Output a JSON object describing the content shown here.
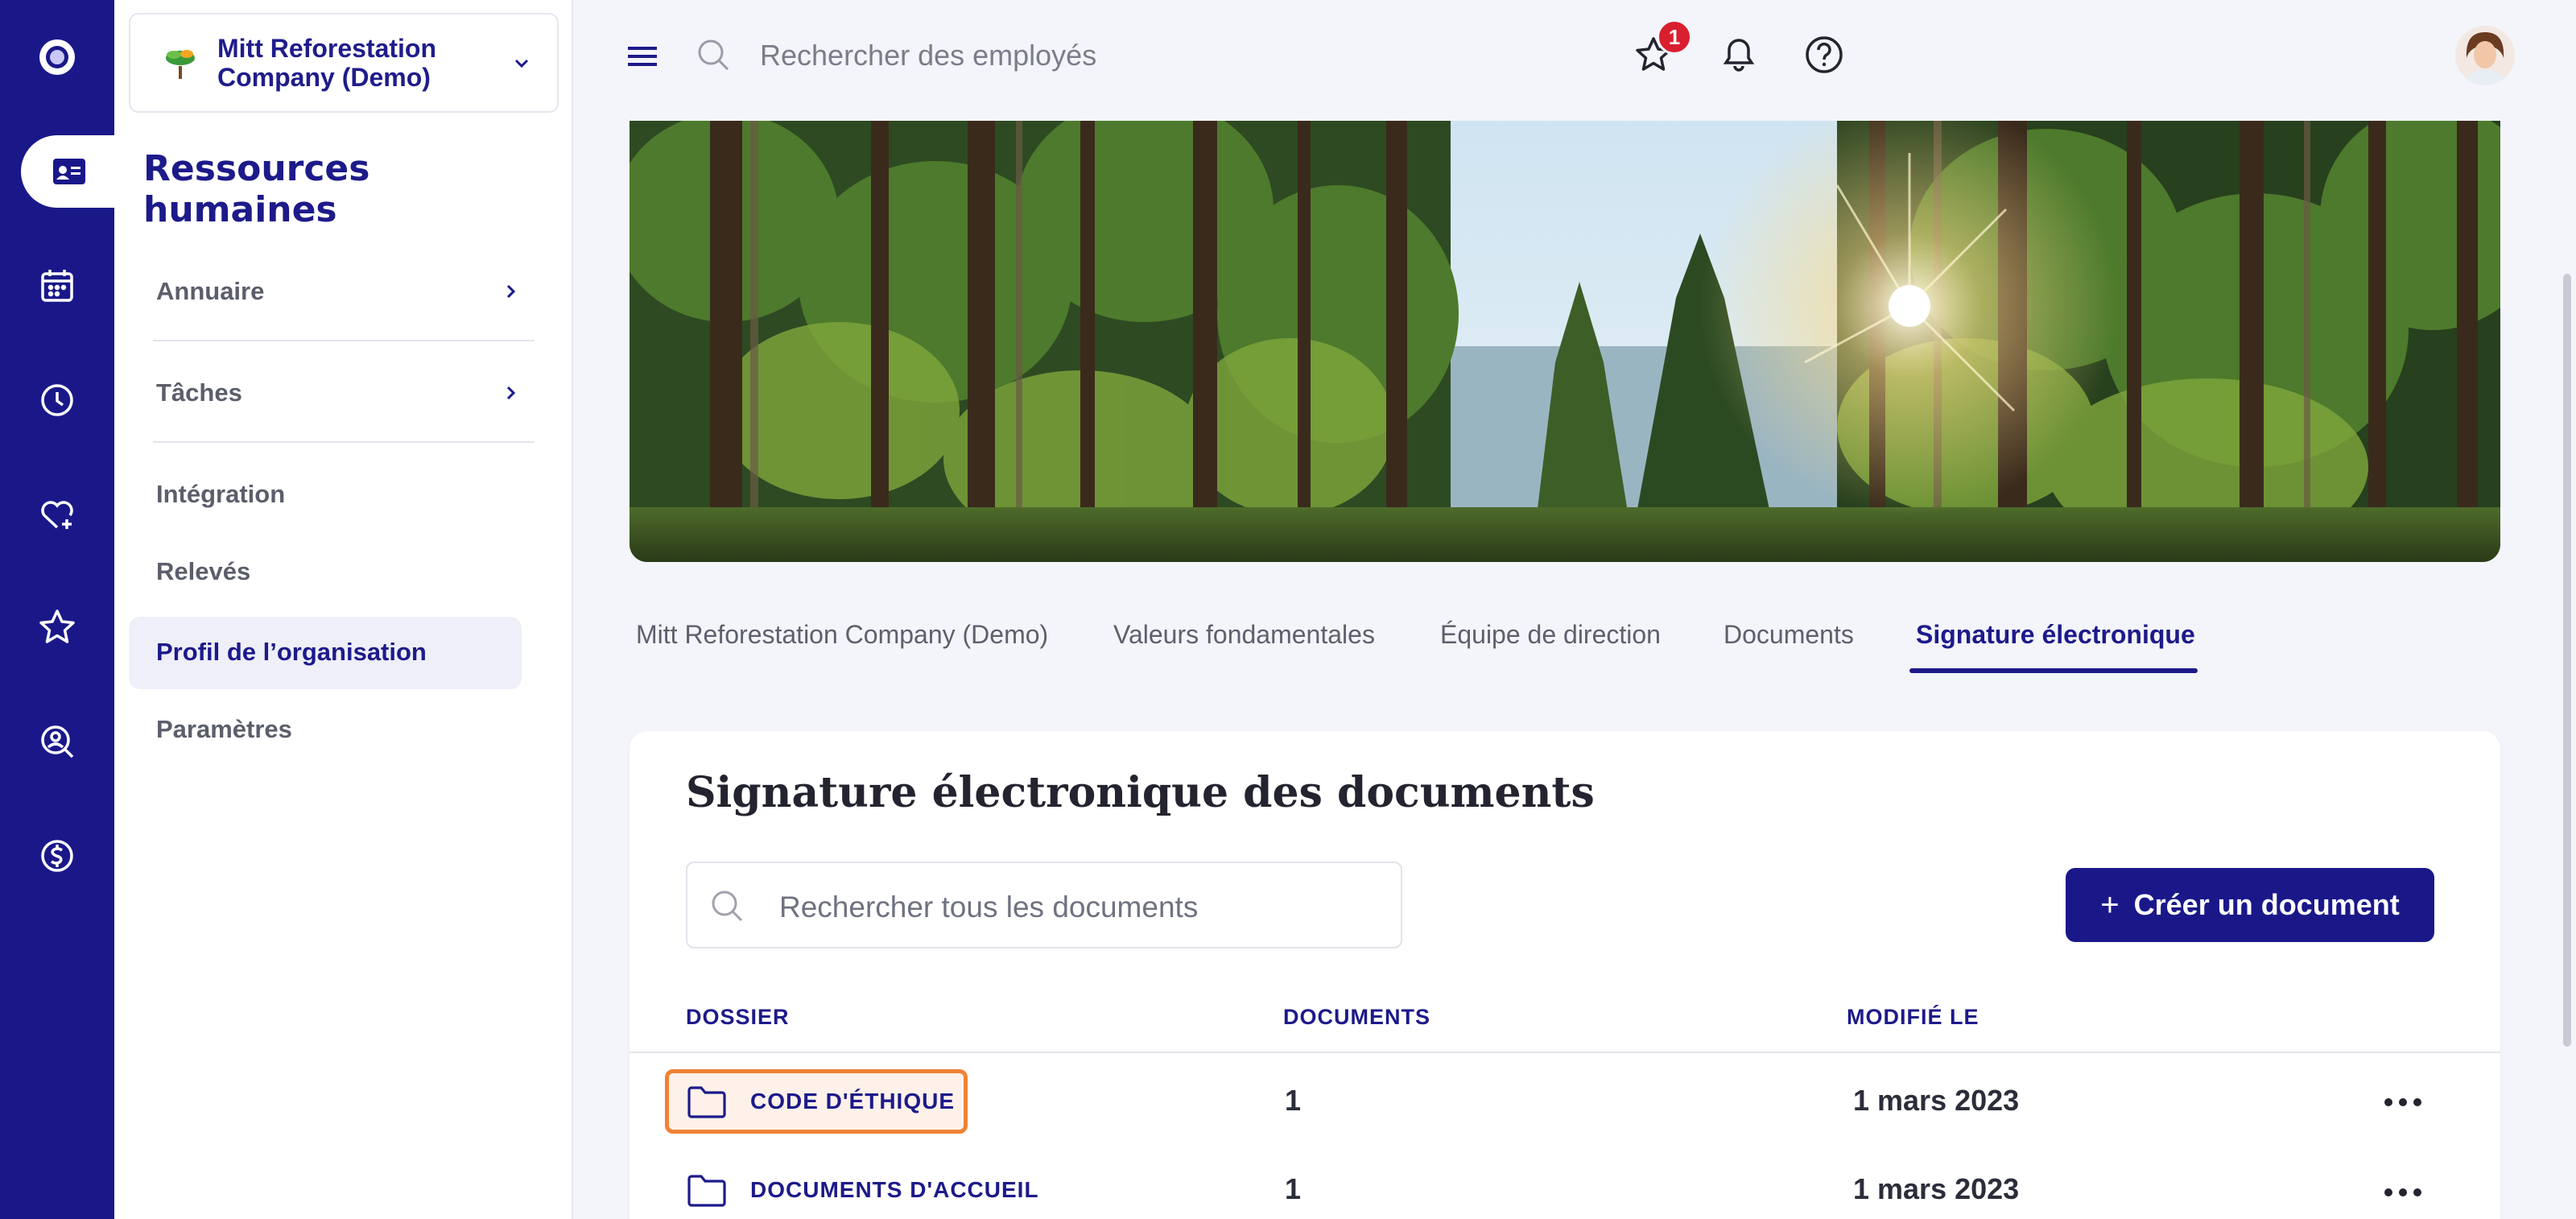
{
  "org": {
    "name": "Mitt Reforestation Company (Demo)"
  },
  "sidebar": {
    "title": "Ressources humaines",
    "items": [
      {
        "label": "Annuaire"
      },
      {
        "label": "Tâches"
      },
      {
        "label": "Intégration"
      },
      {
        "label": "Relevés"
      },
      {
        "label": "Profil de l’organisation"
      },
      {
        "label": "Paramètres"
      }
    ]
  },
  "topbar": {
    "search_placeholder": "Rechercher des employés",
    "favorites_badge": "1"
  },
  "tabs": [
    {
      "label": "Mitt Reforestation Company (Demo)"
    },
    {
      "label": "Valeurs fondamentales"
    },
    {
      "label": "Équipe de direction"
    },
    {
      "label": "Documents"
    },
    {
      "label": "Signature électronique"
    }
  ],
  "card": {
    "title": "Signature électronique des documents",
    "search_placeholder": "Rechercher tous les documents",
    "create_label": "Créer un document",
    "columns": {
      "folder": "DOSSIER",
      "documents": "DOCUMENTS",
      "modified": "MODIFIÉ LE"
    },
    "rows": [
      {
        "folder": "CODE D'ÉTHIQUE",
        "documents": "1",
        "modified": "1 mars 2023"
      },
      {
        "folder": "DOCUMENTS D'ACCUEIL",
        "documents": "1",
        "modified": "1 mars 2023"
      }
    ]
  },
  "colors": {
    "brand": "#1a1889",
    "highlight": "#f08235",
    "badge": "#d91f2f"
  }
}
